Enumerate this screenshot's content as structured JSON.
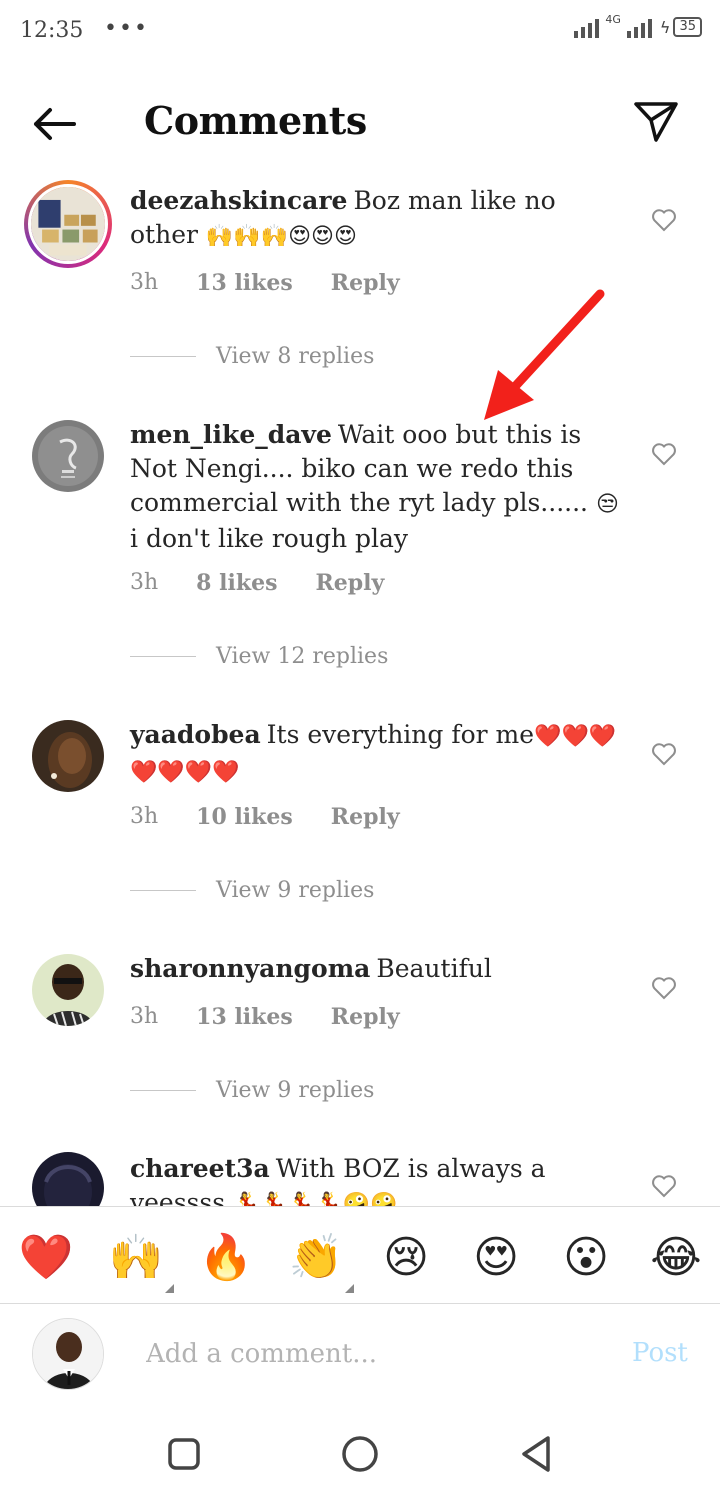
{
  "status_bar": {
    "time": "12:35",
    "dots": "•••",
    "network": "4G",
    "battery": "35"
  },
  "header": {
    "title": "Comments",
    "back_icon": "arrow-left-icon",
    "send_icon": "paper-plane-icon"
  },
  "comments": [
    {
      "username": "deezahskincare",
      "text": "Boz man like no other",
      "emojis": "🙌🙌🙌😍😍😍",
      "time": "3h",
      "likes": "13 likes",
      "reply": "Reply",
      "view_replies": "View 8 replies"
    },
    {
      "username": "men_like_dave",
      "text": "Wait ooo but this is Not Nengi.... biko can we redo this commercial with the ryt lady pls......",
      "emoji_prefix": "😒",
      "text_after": "i don't like rough play",
      "time": "3h",
      "likes": "8 likes",
      "reply": "Reply",
      "view_replies": "View 12 replies"
    },
    {
      "username": "yaadobea",
      "text": "Its everything for me",
      "emojis": "❤️❤️❤️❤️❤️❤️❤️",
      "time": "3h",
      "likes": "10 likes",
      "reply": "Reply",
      "view_replies": "View 9 replies"
    },
    {
      "username": "sharonnyangoma",
      "text": "Beautiful",
      "time": "3h",
      "likes": "13 likes",
      "reply": "Reply",
      "view_replies": "View 9 replies"
    },
    {
      "username": "chareet3a",
      "text": "With BOZ is always a yeessss",
      "emojis": "💃💃💃💃🤪🤪"
    }
  ],
  "emoji_bar": [
    "❤️",
    "🙌",
    "🔥",
    "👏",
    "😢",
    "😍",
    "😮",
    "😂"
  ],
  "composer": {
    "placeholder": "Add a comment...",
    "post_label": "Post"
  },
  "colors": {
    "link_muted": "#8e8e8e",
    "post_disabled": "#b2dffc",
    "annotation": "#f2211b"
  }
}
